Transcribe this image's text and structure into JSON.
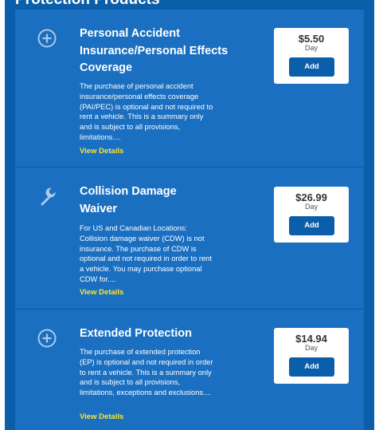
{
  "section": {
    "title": "Protection Products"
  },
  "colors": {
    "panel_background": "#0b5ea9",
    "card_background": "#1a6fc1",
    "link_yellow": "#ffe52c",
    "button_blue": "#0b5ea9"
  },
  "products": [
    {
      "icon": "plus-circle-icon",
      "title": "Personal Accident Insurance/Personal Effects Coverage",
      "description": "The purchase of personal accident insurance/personal effects coverage (PAI/PEC) is optional and not required to rent a vehicle. This is a summary only and is subject to all provisions, limitations....",
      "link": "View Details",
      "price": "$5.50",
      "per": "Day",
      "button": "Add"
    },
    {
      "icon": "wrench-icon",
      "title": "Collision Damage Waiver",
      "description": "For US and Canadian Locations: Collision damage waiver (CDW) is not insurance. The purchase of CDW is optional and not required in order to rent a vehicle. You may purchase optional CDW for....",
      "link": "View Details",
      "price": "$26.99",
      "per": "Day",
      "button": "Add"
    },
    {
      "icon": "plus-circle-icon",
      "title": "Extended Protection",
      "description": "The purchase of extended protection (EP) is optional and not required in order to rent a vehicle. This is a summary only and is subject to all provisions, limitations, exceptions and exclusions....",
      "link": "View Details",
      "price": "$14.94",
      "per": "Day",
      "button": "Add"
    }
  ]
}
